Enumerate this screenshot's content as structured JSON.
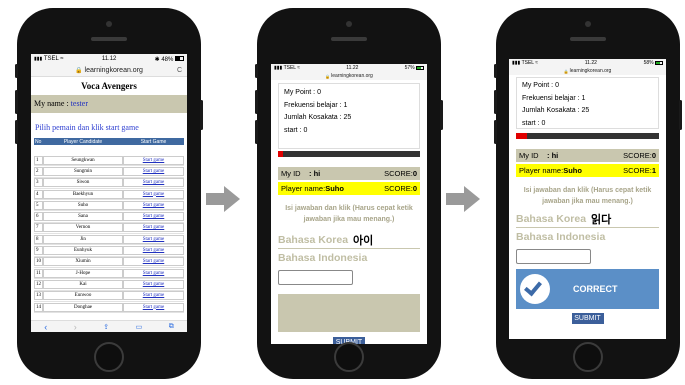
{
  "status": {
    "carrier": "TSEL",
    "time": "11.12",
    "time2": "11.22",
    "battery": "48%",
    "battery2": "57%",
    "battery3": "58%"
  },
  "browser": {
    "url": "learningkorean.org",
    "url_small": "learningkorean.org",
    "reload": "C"
  },
  "screen1": {
    "title": "Voca Avengers",
    "myname_label": "My name : ",
    "myname_value": "tester",
    "instruction": "Pilih pemain dan klik start game",
    "table": {
      "headers": [
        "No",
        "Player Candidate",
        "Start Game"
      ],
      "rows": [
        [
          "1",
          "Seungkwan",
          "Start game"
        ],
        [
          "2",
          "Sungmin",
          "Start game"
        ],
        [
          "3",
          "Siwon",
          "Start game"
        ],
        [
          "4",
          "Baekhyun",
          "Start game"
        ],
        [
          "5",
          "Suho",
          "Start game"
        ],
        [
          "6",
          "Sana",
          "Start game"
        ],
        [
          "7",
          "Vernon",
          "Start game"
        ],
        [
          "8",
          "Jin",
          "Start game"
        ],
        [
          "9",
          "Eunhyuk",
          "Start game"
        ],
        [
          "10",
          "Xiumin",
          "Start game"
        ],
        [
          "11",
          "J-Hope",
          "Start game"
        ],
        [
          "12",
          "Kai",
          "Start game"
        ],
        [
          "13",
          "Eunwoo",
          "Start game"
        ],
        [
          "14",
          "Donghae",
          "Start game"
        ]
      ]
    }
  },
  "quiz": {
    "mypoint": "My Point :  0",
    "freq": "Frekuensi belajar :  1",
    "jumlah": "Jumlah Kosakata :  25",
    "start": "start :  0",
    "myid_label": "My ID",
    "myid_value": ":  hi",
    "score_label": "SCORE:",
    "player_label": "Player name: ",
    "player_value": "Suho",
    "instruction": "Isi jawaban dan klik (Harus cepat ketik jawaban jika mau menang.)",
    "korea_label": "Bahasa Korea",
    "indo_label": "Bahasa Indonesia",
    "submit": "SUBMIT",
    "correct": "CORRECT"
  },
  "quiz2": {
    "my_score": "0",
    "player_score": "0",
    "word": "아이"
  },
  "quiz3": {
    "my_score": "0",
    "player_score": "1",
    "word": "읽다",
    "progress_fraction": 0.08
  },
  "colors": {
    "phone": "#121212",
    "olive": "#c9c7af",
    "yellow": "#ffff00",
    "blue_btn": "#3c5f9a",
    "correct_bg": "#5b8fc7",
    "red": "#e00000",
    "arrow": "#9a9a9a"
  }
}
